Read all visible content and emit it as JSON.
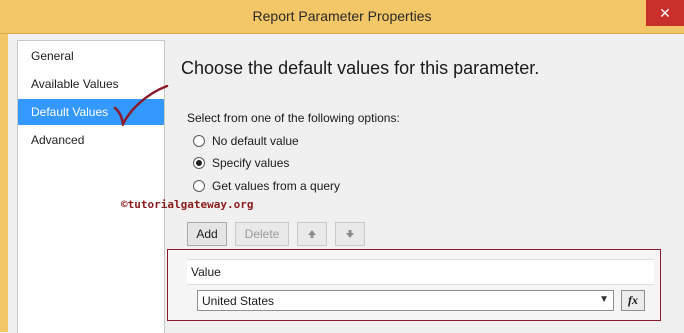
{
  "window": {
    "title": "Report Parameter Properties",
    "close_label": "✕"
  },
  "nav": {
    "items": [
      {
        "label": "General"
      },
      {
        "label": "Available Values"
      },
      {
        "label": "Default Values",
        "selected": true
      },
      {
        "label": "Advanced"
      }
    ]
  },
  "main": {
    "heading": "Choose the default values for this parameter.",
    "options_label": "Select from one of the following options:",
    "options": [
      {
        "label": "No default value",
        "checked": false
      },
      {
        "label": "Specify values",
        "checked": true
      },
      {
        "label": "Get values from a query",
        "checked": false
      }
    ],
    "watermark": "©tutorialgateway.org",
    "toolbar": {
      "add_label": "Add",
      "delete_label": "Delete",
      "move_up_icon": "arrow-up-icon",
      "move_down_icon": "arrow-down-icon"
    },
    "values_grid": {
      "header": "Value",
      "rows": [
        {
          "value": "United States"
        }
      ],
      "expression_label": "fx"
    }
  },
  "colors": {
    "title_bar": "#f3c767",
    "close_button": "#c9302c",
    "selection": "#3399ff",
    "annotation": "#8a1a2a"
  }
}
